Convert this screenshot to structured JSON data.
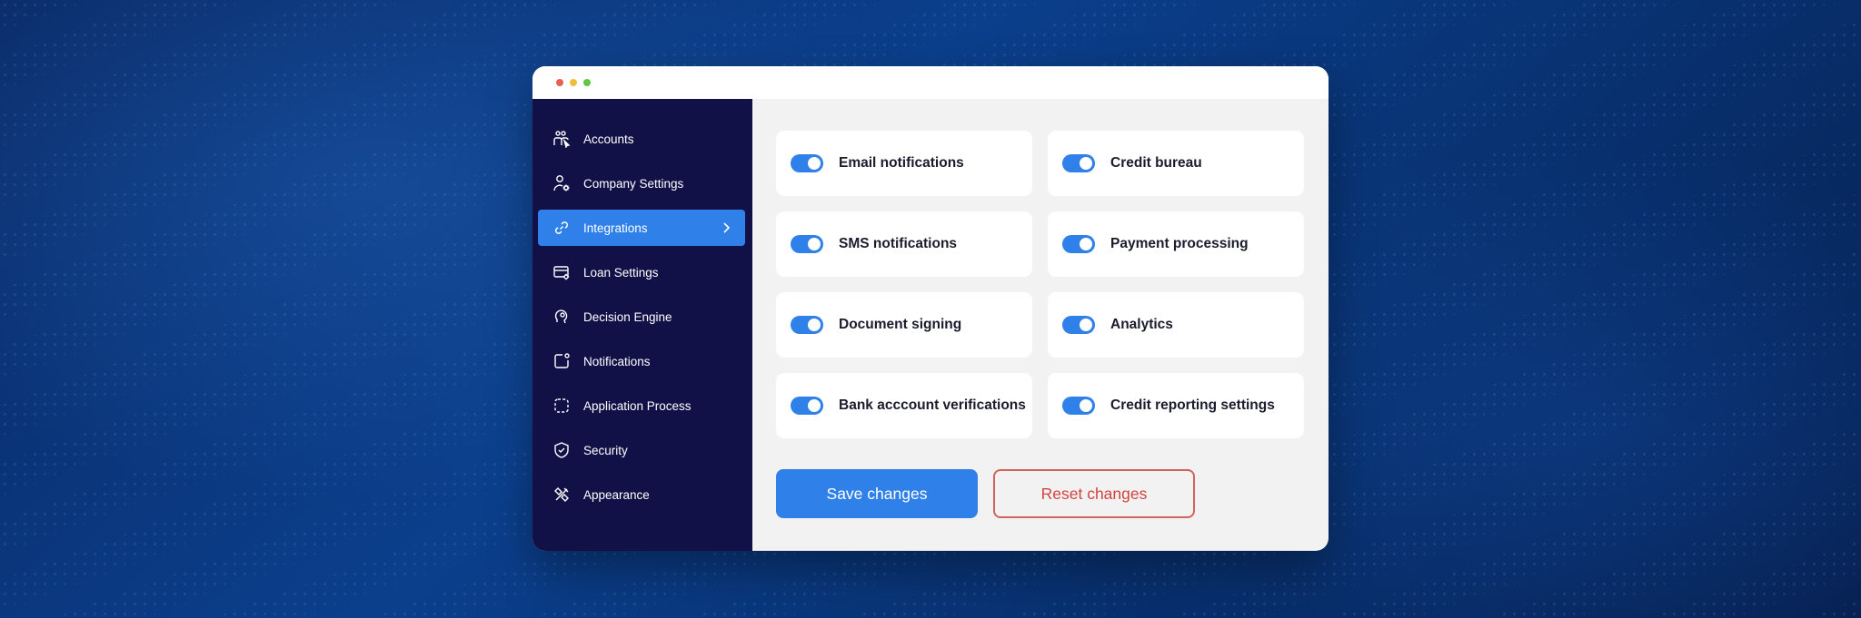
{
  "window": {
    "controls": [
      "close",
      "minimize",
      "maximize"
    ]
  },
  "sidebar": {
    "items": [
      {
        "label": "Accounts",
        "icon": "accounts-icon"
      },
      {
        "label": "Company Settings",
        "icon": "company-settings-icon"
      },
      {
        "label": "Integrations",
        "icon": "integrations-icon",
        "active": true
      },
      {
        "label": "Loan Settings",
        "icon": "loan-settings-icon"
      },
      {
        "label": "Decision Engine",
        "icon": "decision-engine-icon"
      },
      {
        "label": "Notifications",
        "icon": "notifications-icon"
      },
      {
        "label": "Application Process",
        "icon": "application-process-icon"
      },
      {
        "label": "Security",
        "icon": "security-icon"
      },
      {
        "label": "Appearance",
        "icon": "appearance-icon"
      }
    ]
  },
  "integrations": [
    {
      "label": "Email notifications",
      "enabled": true
    },
    {
      "label": "Credit bureau",
      "enabled": true
    },
    {
      "label": "SMS notifications",
      "enabled": true
    },
    {
      "label": "Payment processing",
      "enabled": true
    },
    {
      "label": "Document signing",
      "enabled": true
    },
    {
      "label": "Analytics",
      "enabled": true
    },
    {
      "label": "Bank acccount verifications",
      "enabled": true
    },
    {
      "label": "Credit reporting settings",
      "enabled": true
    }
  ],
  "actions": {
    "save_label": "Save changes",
    "reset_label": "Reset changes"
  },
  "colors": {
    "accent": "#2f80e8",
    "sidebar_bg": "#111148",
    "reset": "#d2433f"
  }
}
